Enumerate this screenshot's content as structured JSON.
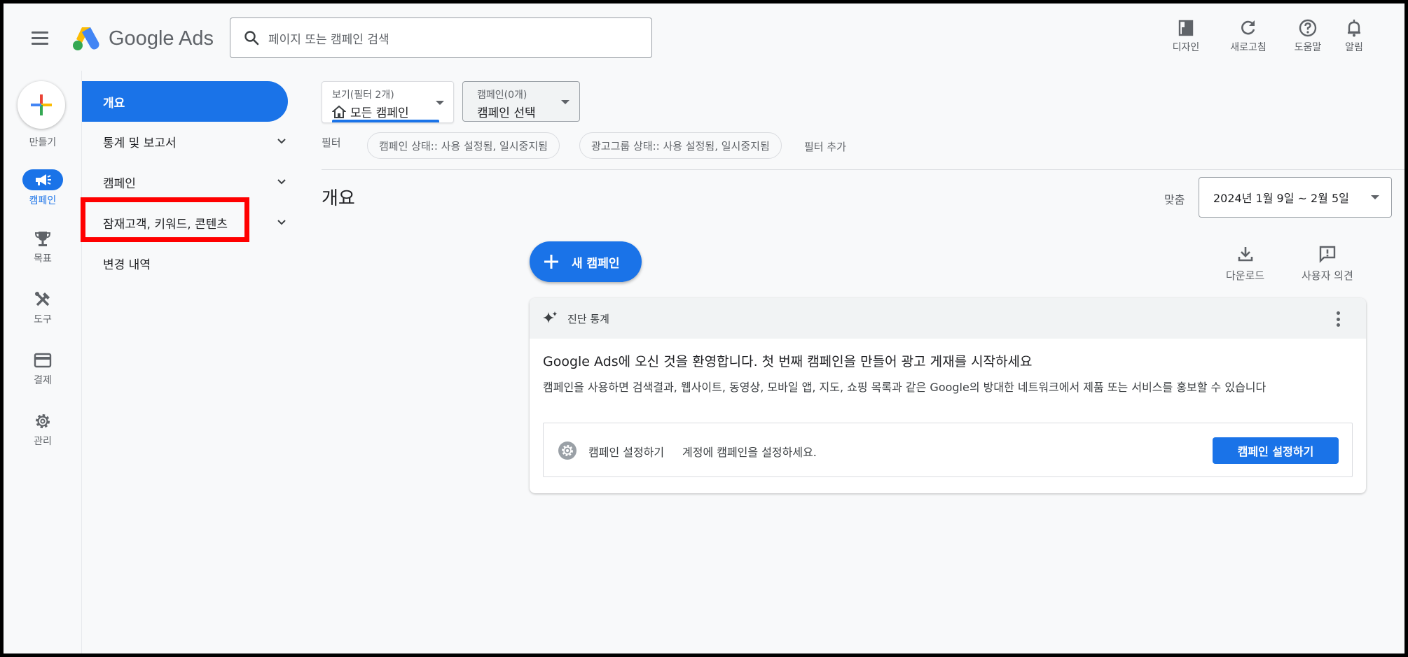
{
  "header": {
    "logo_text": "Google Ads",
    "search_placeholder": "페이지 또는 캠페인 검색",
    "buttons": [
      {
        "label": "디자인",
        "icon": "layout-icon"
      },
      {
        "label": "새로고침",
        "icon": "refresh-icon"
      },
      {
        "label": "도움말",
        "icon": "help-icon"
      },
      {
        "label": "알림",
        "icon": "bell-icon"
      }
    ]
  },
  "rail": {
    "create_label": "만들기",
    "items": [
      {
        "label": "캠페인",
        "icon": "megaphone-icon",
        "active": true
      },
      {
        "label": "목표",
        "icon": "trophy-icon"
      },
      {
        "label": "도구",
        "icon": "tools-icon"
      },
      {
        "label": "결제",
        "icon": "credit-card-icon"
      },
      {
        "label": "관리",
        "icon": "gear-icon"
      }
    ]
  },
  "nav": {
    "items": [
      {
        "label": "개요",
        "active": true
      },
      {
        "label": "통계 및 보고서",
        "expandable": true
      },
      {
        "label": "캠페인",
        "expandable": true
      },
      {
        "label": "잠재고객, 키워드, 콘텐츠",
        "expandable": true,
        "highlighted": true
      },
      {
        "label": "변경 내역"
      }
    ]
  },
  "main": {
    "view": {
      "small": "보기(필터 2개)",
      "value": "모든 캠페인"
    },
    "campaign_select": {
      "small": "캠페인(0개)",
      "value": "캠페인 선택"
    },
    "filter_label": "필터",
    "filters": [
      "캠페인 상태:: 사용 설정됨, 일시중지됨",
      "광고그룹 상태:: 사용 설정됨, 일시중지됨"
    ],
    "add_filter": "필터 추가",
    "page_title": "개요",
    "date_label": "맞춤",
    "date_range": "2024년 1월 9일 ~ 2월 5일",
    "new_campaign": "새 캠페인",
    "download": "다운로드",
    "feedback": "사용자 의견",
    "card": {
      "title": "진단 통계",
      "welcome_brand": "Google Ads",
      "welcome_rest": "에 오신 것을 환영합니다. 첫 번째 캠페인을 만들어 광고 게재를 시작하세요",
      "description": "캠페인을 사용하면 검색결과, 웹사이트, 동영상, 모바일 앱, 지도, 쇼핑 목록과 같은 Google의 방대한 네트워크에서 제품 또는 서비스를 홍보할 수 있습니다",
      "setup_title": "캠페인 설정하기",
      "setup_desc": "계정에 캠페인을 설정하세요.",
      "setup_button": "캠페인 설정하기"
    }
  },
  "colors": {
    "accent": "#1a73e8",
    "highlight": "#ff0000",
    "surface": "#f8f9fa"
  }
}
